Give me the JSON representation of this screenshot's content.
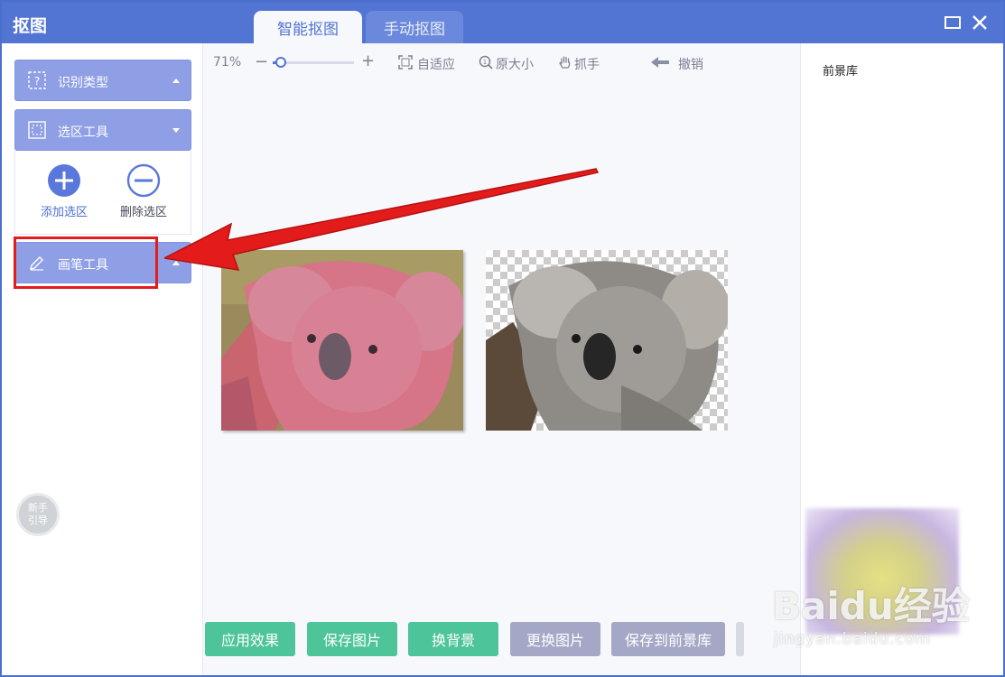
{
  "window": {
    "title": "抠图",
    "tabs": [
      {
        "label": "智能抠图",
        "active": true
      },
      {
        "label": "手动抠图",
        "active": false
      }
    ],
    "accent_color": "#5274d3"
  },
  "left_panel": {
    "recognize_type": "识别类型",
    "selection_tool": "选区工具",
    "add_selection": "添加选区",
    "remove_selection": "删除选区",
    "brush_tool": "画笔工具",
    "guide_line1": "新手",
    "guide_line2": "引导"
  },
  "toolbar": {
    "zoom_value": "71%",
    "zoom_percent": 71,
    "zoom_minus": "−",
    "zoom_plus": "+",
    "fit": "自适应",
    "original_size": "原大小",
    "hand": "抓手",
    "undo": "撤销"
  },
  "right_panel": {
    "title": "前景库"
  },
  "actions": {
    "apply": "应用效果",
    "save_image": "保存图片",
    "change_bg": "换背景",
    "replace_image": "更换图片",
    "save_to_fg": "保存到前景库"
  },
  "watermark": {
    "brand": "Baidu经验",
    "url": "jingyan.baidu.com"
  },
  "annotation_color": "#e41b1b"
}
